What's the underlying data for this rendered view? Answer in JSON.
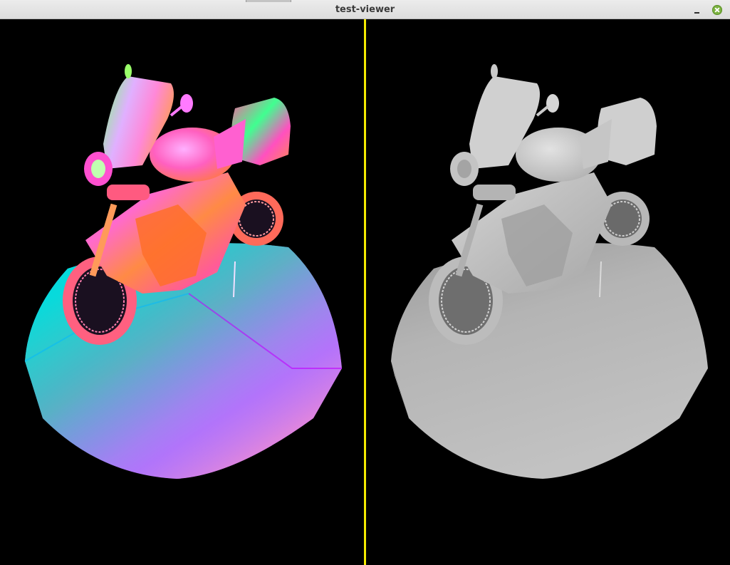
{
  "window": {
    "title": "test-viewer"
  },
  "viewports": {
    "left": {
      "view": "normal-map",
      "mesh": "motorcycle"
    },
    "right": {
      "view": "ambient-occlusion",
      "mesh": "motorcycle"
    }
  },
  "icons": {
    "minimize": "minimize-icon",
    "close": "close-icon"
  },
  "colors": {
    "background": "#000000",
    "divider": "#f5ea00",
    "titlebar": "#e4e4e4",
    "close_button": "#7bb240"
  }
}
